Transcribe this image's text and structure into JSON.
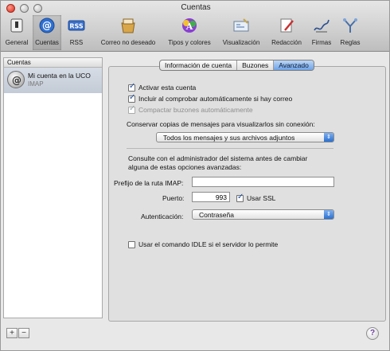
{
  "window": {
    "title": "Cuentas"
  },
  "toolbar": {
    "items": [
      {
        "label": "General",
        "icon": "switch-icon"
      },
      {
        "label": "Cuentas",
        "icon": "at-sign-icon"
      },
      {
        "label": "RSS",
        "icon": "rss-icon"
      },
      {
        "label": "Correo no deseado",
        "icon": "junk-mail-icon"
      },
      {
        "label": "Tipos y colores",
        "icon": "fonts-colors-icon"
      },
      {
        "label": "Visualización",
        "icon": "viewing-icon"
      },
      {
        "label": "Redacción",
        "icon": "composing-icon"
      },
      {
        "label": "Firmas",
        "icon": "signature-icon"
      },
      {
        "label": "Reglas",
        "icon": "rules-icon"
      }
    ]
  },
  "sidebar": {
    "header": "Cuentas",
    "account": {
      "name": "Mi cuenta en la UCO",
      "type": "IMAP"
    },
    "add_label": "+",
    "remove_label": "−"
  },
  "tabs": [
    {
      "label": "Información de cuenta",
      "active": false
    },
    {
      "label": "Buzones",
      "active": false
    },
    {
      "label": "Avanzado",
      "active": true
    }
  ],
  "advanced": {
    "activate": "Activar esta cuenta",
    "include_check": "Incluir al comprobar automáticamente si hay correo",
    "compact": "Compactar buzones automáticamente",
    "offline_label": "Conservar copias de mensajes para visualizarlos sin conexión:",
    "offline_value": "Todos los mensajes y sus archivos adjuntos",
    "admin_note_1": "Consulte con el administrador del sistema antes de cambiar",
    "admin_note_2": "alguna de estas opciones avanzadas:",
    "imap_prefix_label": "Prefijo de la ruta IMAP:",
    "imap_prefix_value": "",
    "port_label": "Puerto:",
    "port_value": "993",
    "ssl_label": "Usar SSL",
    "auth_label": "Autenticación:",
    "auth_value": "Contraseña",
    "idle_label": "Usar el comando IDLE si el servidor lo permite"
  },
  "help": {
    "label": "?"
  },
  "colors": {
    "accent": "#3b7fe0",
    "selected_tab": "#6ea2e6"
  }
}
